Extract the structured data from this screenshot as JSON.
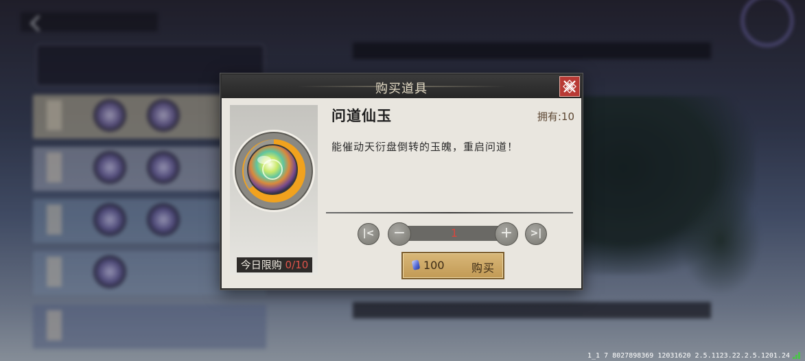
{
  "dialog": {
    "title": "购买道具",
    "item_name": "问道仙玉",
    "own_label": "拥有:10",
    "description": "能催动天衍盘倒转的玉魄，重启问道！",
    "limit_label": "今日限购",
    "limit_count": "0/10",
    "quantity": "1",
    "price": "100",
    "buy_label": "购买"
  },
  "footer": {
    "build_info": "1_1 7 8027898369  12031620  2.5.1123.22.2.5.1201.24"
  },
  "icons": {
    "close": "close-icon",
    "min": "min-icon",
    "minus": "minus-icon",
    "plus": "plus-icon",
    "max": "max-icon",
    "currency": "jade-gem-icon",
    "item": "jade-orb-icon",
    "signal": "signal-icon"
  },
  "colors": {
    "title_bar": "#2f2f2f",
    "close_button": "#b83a35",
    "quantity_text": "#d9463d",
    "limit_count": "#e0534a",
    "buy_button": "#c9a561"
  }
}
